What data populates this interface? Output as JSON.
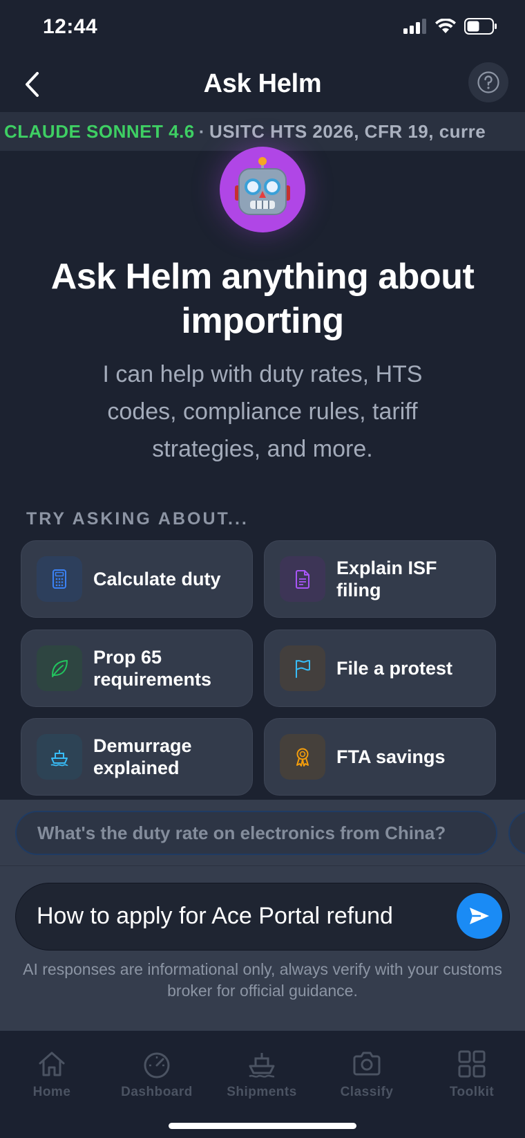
{
  "status_bar": {
    "time": "12:44"
  },
  "header": {
    "title": "Ask Helm"
  },
  "ticker": {
    "model": "CLAUDE SONNET 4.6",
    "separator": "·",
    "sources": "USITC HTS 2026, CFR 19, curre"
  },
  "hero": {
    "title": "Ask Helm anything about importing",
    "subtitle": "I can help with duty rates, HTS codes, compliance rules, tariff strategies, and more."
  },
  "suggestions": {
    "label": "TRY ASKING ABOUT...",
    "items": [
      {
        "label": "Calculate duty",
        "icon": "calculator-icon",
        "color": "#3b82f6"
      },
      {
        "label": "Explain ISF filing",
        "icon": "document-icon",
        "color": "#a855f7"
      },
      {
        "label": "Prop 65 requirements",
        "icon": "leaf-icon",
        "color": "#22c55e"
      },
      {
        "label": "File a protest",
        "icon": "flag-icon",
        "color": "#38bdf8"
      },
      {
        "label": "Demurrage explained",
        "icon": "ship-icon",
        "color": "#38bdf8"
      },
      {
        "label": "FTA savings",
        "icon": "award-icon",
        "color": "#f59e0b"
      }
    ]
  },
  "composer": {
    "quick_prompt": "What's the duty rate on electronics from China?",
    "input_value": "How to apply for Ace Portal refund",
    "disclaimer": "AI responses are informational only, always verify with your customs broker for official guidance."
  },
  "tabs": [
    {
      "label": "Home",
      "icon": "home-icon"
    },
    {
      "label": "Dashboard",
      "icon": "gauge-icon"
    },
    {
      "label": "Shipments",
      "icon": "ship-icon"
    },
    {
      "label": "Classify",
      "icon": "camera-icon"
    },
    {
      "label": "Toolkit",
      "icon": "grid-icon"
    }
  ],
  "colors": {
    "background": "#1c2230",
    "accent": "#1a8bf5",
    "model_green": "#3ecf63",
    "avatar": "#b046e6"
  }
}
